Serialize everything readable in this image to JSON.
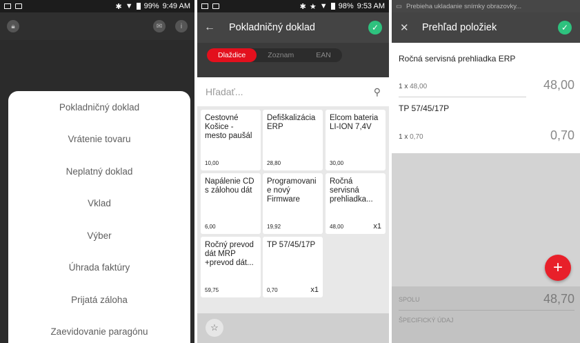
{
  "screen1": {
    "status": {
      "battery": "99%",
      "time": "9:49 AM"
    },
    "menu": [
      "Pokladničný doklad",
      "Vrátenie tovaru",
      "Neplatný doklad",
      "Vklad",
      "Výber",
      "Úhrada faktúry",
      "Prijatá záloha",
      "Zaevidovanie paragónu"
    ]
  },
  "screen2": {
    "status": {
      "battery": "98%",
      "time": "9:53 AM"
    },
    "title": "Pokladničný doklad",
    "tabs": [
      "Dlaždice",
      "Zoznam",
      "EAN"
    ],
    "active_tab": "Dlaždice",
    "search_placeholder": "Hľadať...",
    "tiles": [
      {
        "name": "Cestovné Košice - mesto paušál",
        "price": "10,00",
        "qty": ""
      },
      {
        "name": "Defiškalizácia ERP",
        "price": "28,80",
        "qty": ""
      },
      {
        "name": "Elcom bateria LI-ION 7,4V",
        "price": "30,00",
        "qty": ""
      },
      {
        "name": "Napálenie CD s zálohou dát",
        "price": "6,00",
        "qty": ""
      },
      {
        "name": "Programovani e nový Firmware",
        "price": "19,92",
        "qty": ""
      },
      {
        "name": "Ročná servisná prehliadka...",
        "price": "48,00",
        "qty": "x1"
      },
      {
        "name": "Ročný prevod dát MRP +prevod dát...",
        "price": "59,75",
        "qty": ""
      },
      {
        "name": "TP 57/45/17P",
        "price": "0,70",
        "qty": "x1"
      }
    ]
  },
  "screen3": {
    "notification": "Prebieha ukladanie snímky obrazovky...",
    "title": "Prehľad položiek",
    "items": [
      {
        "name": "Ročná servisná prehliadka ERP",
        "qty": "1 x",
        "unit": "48,00",
        "total": "48,00"
      },
      {
        "name": "TP 57/45/17P",
        "qty": "1 x",
        "unit": "0,70",
        "total": "0,70"
      }
    ],
    "sum_label": "SPOLU",
    "sum_value": "48,70",
    "specific_label": "ŠPECIFICKÝ ÚDAJ"
  },
  "colors": {
    "accent_red": "#e3101d",
    "confirm_green": "#2ec27e"
  }
}
